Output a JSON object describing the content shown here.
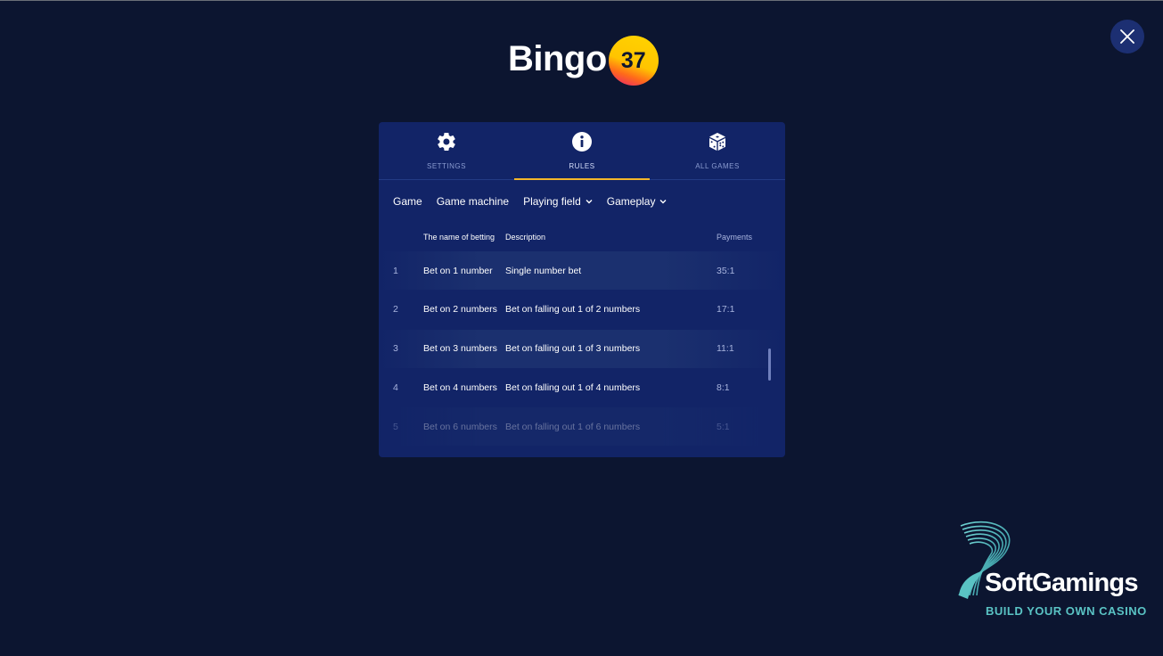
{
  "logo": {
    "text": "Bingo",
    "number": "37"
  },
  "close": {
    "icon": "close-icon"
  },
  "tabs": [
    {
      "label": "SETTINGS",
      "icon": "gear-icon",
      "active": false
    },
    {
      "label": "RULES",
      "icon": "info-icon",
      "active": true
    },
    {
      "label": "ALL GAMES",
      "icon": "dice-icon",
      "active": false
    }
  ],
  "subnav": [
    {
      "label": "Game",
      "dropdown": false
    },
    {
      "label": "Game machine",
      "dropdown": false
    },
    {
      "label": "Playing field",
      "dropdown": true
    },
    {
      "label": "Gameplay",
      "dropdown": true
    }
  ],
  "table": {
    "headers": {
      "name": "The name of betting",
      "description": "Description",
      "payments": "Payments"
    },
    "rows": [
      {
        "index": "1",
        "name": "Bet on 1 number",
        "description": "Single number bet",
        "payment": "35:1"
      },
      {
        "index": "2",
        "name": "Bet on 2 numbers",
        "description": "Bet on falling out 1 of 2 numbers",
        "payment": "17:1"
      },
      {
        "index": "3",
        "name": "Bet on 3 numbers",
        "description": "Bet on falling out 1 of 3 numbers",
        "payment": "11:1"
      },
      {
        "index": "4",
        "name": "Bet on 4 numbers",
        "description": "Bet on falling out 1 of 4 numbers",
        "payment": "8:1"
      },
      {
        "index": "5",
        "name": "Bet on 6 numbers",
        "description": "Bet on falling out 1 of 6 numbers",
        "payment": "5:1"
      }
    ]
  },
  "watermark": {
    "name": "SoftGamings",
    "tagline": "BUILD YOUR OWN CASINO"
  },
  "colors": {
    "background": "#0c1530",
    "panel": "#122467",
    "accent": "#f4b62a",
    "brand_teal": "#5ac3c4"
  }
}
